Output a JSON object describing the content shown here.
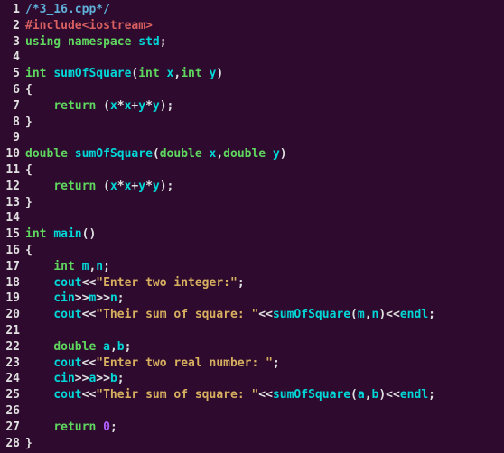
{
  "lines": [
    {
      "num": "1",
      "tokens": [
        [
          "comment",
          "/*3_16.cpp*/"
        ]
      ]
    },
    {
      "num": "2",
      "tokens": [
        [
          "preproc",
          "#include<iostream>"
        ]
      ]
    },
    {
      "num": "3",
      "tokens": [
        [
          "keyword",
          "using"
        ],
        [
          "plain",
          " "
        ],
        [
          "keyword",
          "namespace"
        ],
        [
          "plain",
          " "
        ],
        [
          "ident",
          "std"
        ],
        [
          "plain",
          ";"
        ]
      ]
    },
    {
      "num": "4",
      "tokens": []
    },
    {
      "num": "5",
      "tokens": [
        [
          "type",
          "int"
        ],
        [
          "plain",
          " "
        ],
        [
          "func",
          "sumOfSquare"
        ],
        [
          "plain",
          "("
        ],
        [
          "type",
          "int"
        ],
        [
          "plain",
          " "
        ],
        [
          "ident",
          "x"
        ],
        [
          "plain",
          ","
        ],
        [
          "type",
          "int"
        ],
        [
          "plain",
          " "
        ],
        [
          "ident",
          "y"
        ],
        [
          "plain",
          ")"
        ]
      ]
    },
    {
      "num": "6",
      "tokens": [
        [
          "plain",
          "{"
        ]
      ]
    },
    {
      "num": "7",
      "tokens": [
        [
          "plain",
          "    "
        ],
        [
          "keyword",
          "return"
        ],
        [
          "plain",
          " ("
        ],
        [
          "ident",
          "x"
        ],
        [
          "plain",
          "*"
        ],
        [
          "ident",
          "x"
        ],
        [
          "plain",
          "+"
        ],
        [
          "ident",
          "y"
        ],
        [
          "plain",
          "*"
        ],
        [
          "ident",
          "y"
        ],
        [
          "plain",
          ");"
        ]
      ]
    },
    {
      "num": "8",
      "tokens": [
        [
          "plain",
          "}"
        ]
      ]
    },
    {
      "num": "9",
      "tokens": []
    },
    {
      "num": "10",
      "tokens": [
        [
          "type",
          "double"
        ],
        [
          "plain",
          " "
        ],
        [
          "func",
          "sumOfSquare"
        ],
        [
          "plain",
          "("
        ],
        [
          "type",
          "double"
        ],
        [
          "plain",
          " "
        ],
        [
          "ident",
          "x"
        ],
        [
          "plain",
          ","
        ],
        [
          "type",
          "double"
        ],
        [
          "plain",
          " "
        ],
        [
          "ident",
          "y"
        ],
        [
          "plain",
          ")"
        ]
      ]
    },
    {
      "num": "11",
      "tokens": [
        [
          "plain",
          "{"
        ]
      ]
    },
    {
      "num": "12",
      "tokens": [
        [
          "plain",
          "    "
        ],
        [
          "keyword",
          "return"
        ],
        [
          "plain",
          " ("
        ],
        [
          "ident",
          "x"
        ],
        [
          "plain",
          "*"
        ],
        [
          "ident",
          "x"
        ],
        [
          "plain",
          "+"
        ],
        [
          "ident",
          "y"
        ],
        [
          "plain",
          "*"
        ],
        [
          "ident",
          "y"
        ],
        [
          "plain",
          ");"
        ]
      ]
    },
    {
      "num": "13",
      "tokens": [
        [
          "plain",
          "}"
        ]
      ]
    },
    {
      "num": "14",
      "tokens": []
    },
    {
      "num": "15",
      "tokens": [
        [
          "type",
          "int"
        ],
        [
          "plain",
          " "
        ],
        [
          "func",
          "main"
        ],
        [
          "plain",
          "()"
        ]
      ]
    },
    {
      "num": "16",
      "tokens": [
        [
          "plain",
          "{"
        ]
      ]
    },
    {
      "num": "17",
      "tokens": [
        [
          "plain",
          "    "
        ],
        [
          "type",
          "int"
        ],
        [
          "plain",
          " "
        ],
        [
          "ident",
          "m"
        ],
        [
          "plain",
          ","
        ],
        [
          "ident",
          "n"
        ],
        [
          "plain",
          ";"
        ]
      ]
    },
    {
      "num": "18",
      "tokens": [
        [
          "plain",
          "    "
        ],
        [
          "ident",
          "cout"
        ],
        [
          "plain",
          "<<"
        ],
        [
          "string",
          "\"Enter two integer:\""
        ],
        [
          "plain",
          ";"
        ]
      ]
    },
    {
      "num": "19",
      "tokens": [
        [
          "plain",
          "    "
        ],
        [
          "ident",
          "cin"
        ],
        [
          "plain",
          ">>"
        ],
        [
          "ident",
          "m"
        ],
        [
          "plain",
          ">>"
        ],
        [
          "ident",
          "n"
        ],
        [
          "plain",
          ";"
        ]
      ]
    },
    {
      "num": "20",
      "tokens": [
        [
          "plain",
          "    "
        ],
        [
          "ident",
          "cout"
        ],
        [
          "plain",
          "<<"
        ],
        [
          "string",
          "\"Their sum of square: \""
        ],
        [
          "plain",
          "<<"
        ],
        [
          "func",
          "sumOfSquare"
        ],
        [
          "plain",
          "("
        ],
        [
          "ident",
          "m"
        ],
        [
          "plain",
          ","
        ],
        [
          "ident",
          "n"
        ],
        [
          "plain",
          ")<<"
        ],
        [
          "ident",
          "endl"
        ],
        [
          "plain",
          ";"
        ]
      ]
    },
    {
      "num": "21",
      "tokens": []
    },
    {
      "num": "22",
      "tokens": [
        [
          "plain",
          "    "
        ],
        [
          "type",
          "double"
        ],
        [
          "plain",
          " "
        ],
        [
          "ident",
          "a"
        ],
        [
          "plain",
          ","
        ],
        [
          "ident",
          "b"
        ],
        [
          "plain",
          ";"
        ]
      ]
    },
    {
      "num": "23",
      "tokens": [
        [
          "plain",
          "    "
        ],
        [
          "ident",
          "cout"
        ],
        [
          "plain",
          "<<"
        ],
        [
          "string",
          "\"Enter two real number: \""
        ],
        [
          "plain",
          ";"
        ]
      ]
    },
    {
      "num": "24",
      "tokens": [
        [
          "plain",
          "    "
        ],
        [
          "ident",
          "cin"
        ],
        [
          "plain",
          ">>"
        ],
        [
          "ident",
          "a"
        ],
        [
          "plain",
          ">>"
        ],
        [
          "ident",
          "b"
        ],
        [
          "plain",
          ";"
        ]
      ]
    },
    {
      "num": "25",
      "tokens": [
        [
          "plain",
          "    "
        ],
        [
          "ident",
          "cout"
        ],
        [
          "plain",
          "<<"
        ],
        [
          "string",
          "\"Their sum of square: \""
        ],
        [
          "plain",
          "<<"
        ],
        [
          "func",
          "sumOfSquare"
        ],
        [
          "plain",
          "("
        ],
        [
          "ident",
          "a"
        ],
        [
          "plain",
          ","
        ],
        [
          "ident",
          "b"
        ],
        [
          "plain",
          ")<<"
        ],
        [
          "ident",
          "endl"
        ],
        [
          "plain",
          ";"
        ]
      ]
    },
    {
      "num": "26",
      "tokens": []
    },
    {
      "num": "27",
      "tokens": [
        [
          "plain",
          "    "
        ],
        [
          "keyword",
          "return"
        ],
        [
          "plain",
          " "
        ],
        [
          "number",
          "0"
        ],
        [
          "plain",
          ";"
        ]
      ]
    },
    {
      "num": "28",
      "tokens": [
        [
          "plain",
          "}"
        ]
      ]
    }
  ]
}
